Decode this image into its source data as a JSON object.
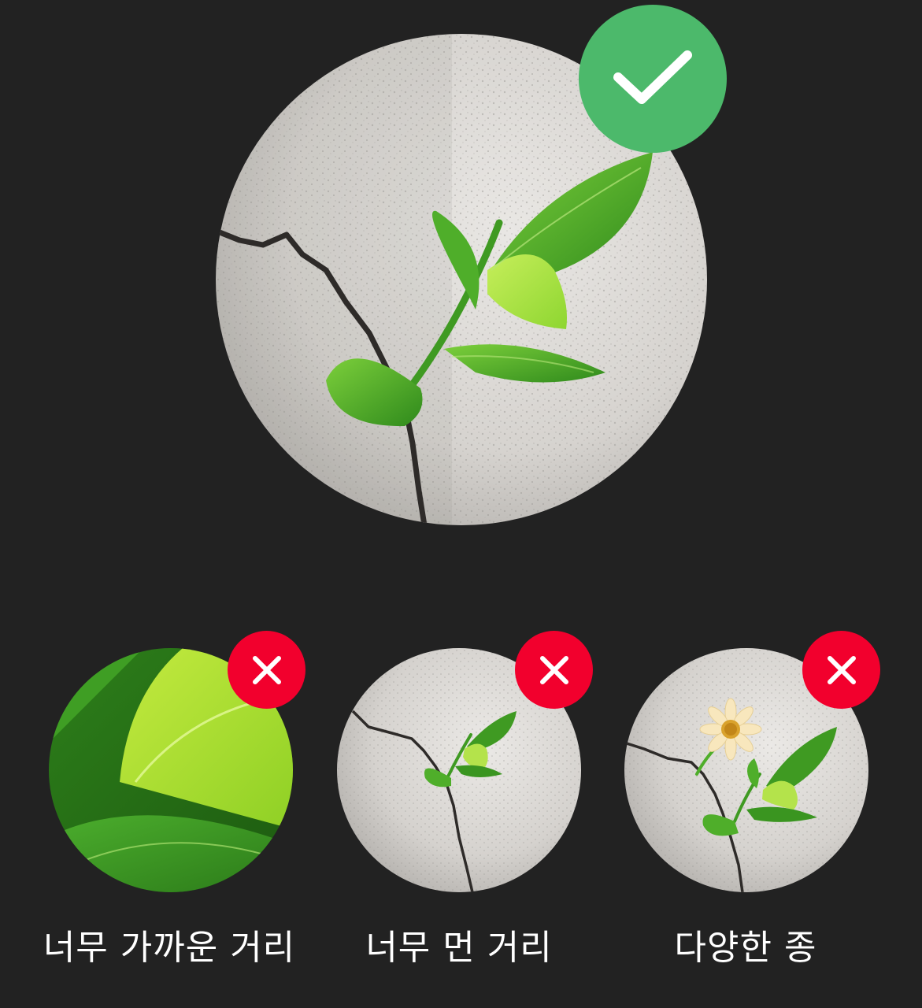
{
  "main_example": {
    "photo_icon": "seedling-in-concrete-crack",
    "status": "correct",
    "status_icon": "check-icon",
    "status_color": "#4CB96B"
  },
  "examples": [
    {
      "label": "너무 가까운 거리",
      "photo_icon": "leaf-closeup",
      "status": "incorrect",
      "status_icon": "close-icon",
      "status_color": "#F2002D"
    },
    {
      "label": "너무 먼 거리",
      "photo_icon": "small-seedling-in-concrete",
      "status": "incorrect",
      "status_icon": "close-icon",
      "status_color": "#F2002D"
    },
    {
      "label": "다양한 종",
      "photo_icon": "seedling-with-daisy",
      "status": "incorrect",
      "status_icon": "close-icon",
      "status_color": "#F2002D"
    }
  ],
  "colors": {
    "background": "#222222",
    "text": "#FFFFFF"
  }
}
